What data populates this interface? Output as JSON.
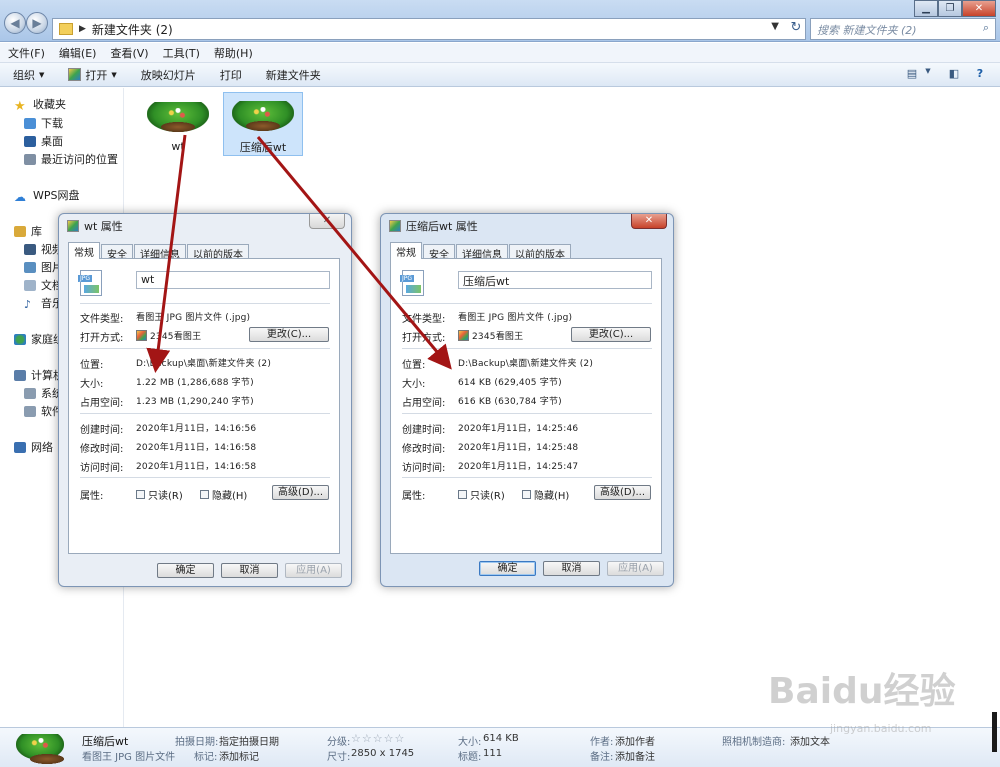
{
  "window": {
    "address_crumb": "新建文件夹 (2)",
    "search_placeholder": "搜索 新建文件夹 (2)"
  },
  "menubar": [
    "文件(F)",
    "编辑(E)",
    "查看(V)",
    "工具(T)",
    "帮助(H)"
  ],
  "toolbar": {
    "organize": "组织",
    "open": "打开",
    "slideshow": "放映幻灯片",
    "print": "打印",
    "new_folder": "新建文件夹"
  },
  "sidebar": {
    "favorites": "收藏夹",
    "downloads": "下载",
    "desktop": "桌面",
    "recent": "最近访问的位置",
    "wps": "WPS网盘",
    "libraries": "库",
    "videos": "视频",
    "pictures": "图片",
    "documents": "文档",
    "music": "音乐",
    "homegroup": "家庭组",
    "computer": "计算机",
    "system": "系统",
    "software": "软件",
    "network": "网络"
  },
  "files": [
    {
      "name": "wt"
    },
    {
      "name": "压缩后wt"
    }
  ],
  "dialog_common": {
    "tabs": [
      "常规",
      "安全",
      "详细信息",
      "以前的版本"
    ],
    "type_label": "文件类型:",
    "type_value": "看图王 JPG 图片文件 (.jpg)",
    "open_label": "打开方式:",
    "open_value": "2345看图王",
    "change_btn": "更改(C)...",
    "location_label": "位置:",
    "size_label": "大小:",
    "disk_label": "占用空间:",
    "created_label": "创建时间:",
    "modified_label": "修改时间:",
    "accessed_label": "访问时间:",
    "attr_label": "属性:",
    "readonly": "只读(R)",
    "hidden": "隐藏(H)",
    "advanced_btn": "高级(D)...",
    "ok": "确定",
    "cancel": "取消",
    "apply": "应用(A)",
    "jpg_badge": "JPG"
  },
  "dialog1": {
    "title": "wt 属性",
    "filename": "wt",
    "location": "D:\\Backup\\桌面\\新建文件夹 (2)",
    "size": "1.22 MB (1,286,688 字节)",
    "disk": "1.23 MB (1,290,240 字节)",
    "created": "2020年1月11日，14:16:56",
    "modified": "2020年1月11日，14:16:58",
    "accessed": "2020年1月11日，14:16:58"
  },
  "dialog2": {
    "title": "压缩后wt 属性",
    "filename": "压缩后wt",
    "location": "D:\\Backup\\桌面\\新建文件夹 (2)",
    "size": "614 KB (629,405 字节)",
    "disk": "616 KB (630,784 字节)",
    "created": "2020年1月11日，14:25:46",
    "modified": "2020年1月11日，14:25:48",
    "accessed": "2020年1月11日，14:25:47"
  },
  "statusbar": {
    "name": "压缩后wt",
    "type": "看图王 JPG 图片文件",
    "shot_date_label": "拍摄日期:",
    "shot_date_value": "指定拍摄日期",
    "tags_label": "标记:",
    "tags_value": "添加标记",
    "rating_label": "分级:",
    "stars": "☆☆☆☆☆",
    "dims_label": "尺寸:",
    "dims_value": "2850 x 1745",
    "size_label": "大小:",
    "size_value": "614 KB",
    "title_label": "标题:",
    "title_value": "111",
    "author_label": "作者:",
    "author_value": "添加作者",
    "comment_label": "备注:",
    "comment_value": "添加备注",
    "maker_label": "照相机制造商:",
    "maker_value": "添加文本"
  },
  "watermark": {
    "brand": "Baidu经验",
    "url": "jingyan.baidu.com"
  },
  "colors": {
    "arrow": "#a31515",
    "titlebar": "#b7cfec",
    "dialog_frame": "#dbe6f3"
  }
}
